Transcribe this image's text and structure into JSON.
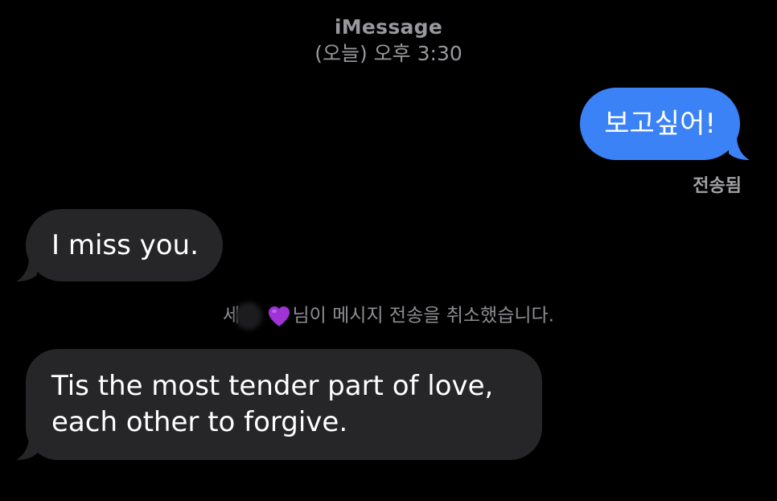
{
  "header": {
    "service": "iMessage",
    "timestamp": "(오늘) 오후 3:30"
  },
  "messages": [
    {
      "direction": "outgoing",
      "text": "보고싶어!"
    },
    {
      "direction": "incoming",
      "text": "I miss you."
    },
    {
      "direction": "incoming",
      "lines": [
        "Tis the most tender part of love,",
        "each other to forgive."
      ]
    }
  ],
  "delivery_status": "전송됨",
  "unsend_notice": {
    "name_visible_prefix": "세",
    "name_emoji_icon": "purple-heart-icon",
    "text": "님이 메시지 전송을 취소했습니다."
  },
  "colors": {
    "background": "#000000",
    "outgoing_bubble": "#3b82f6",
    "incoming_bubble": "#262628",
    "meta_text": "#98989d",
    "heart": "#a033d6"
  }
}
